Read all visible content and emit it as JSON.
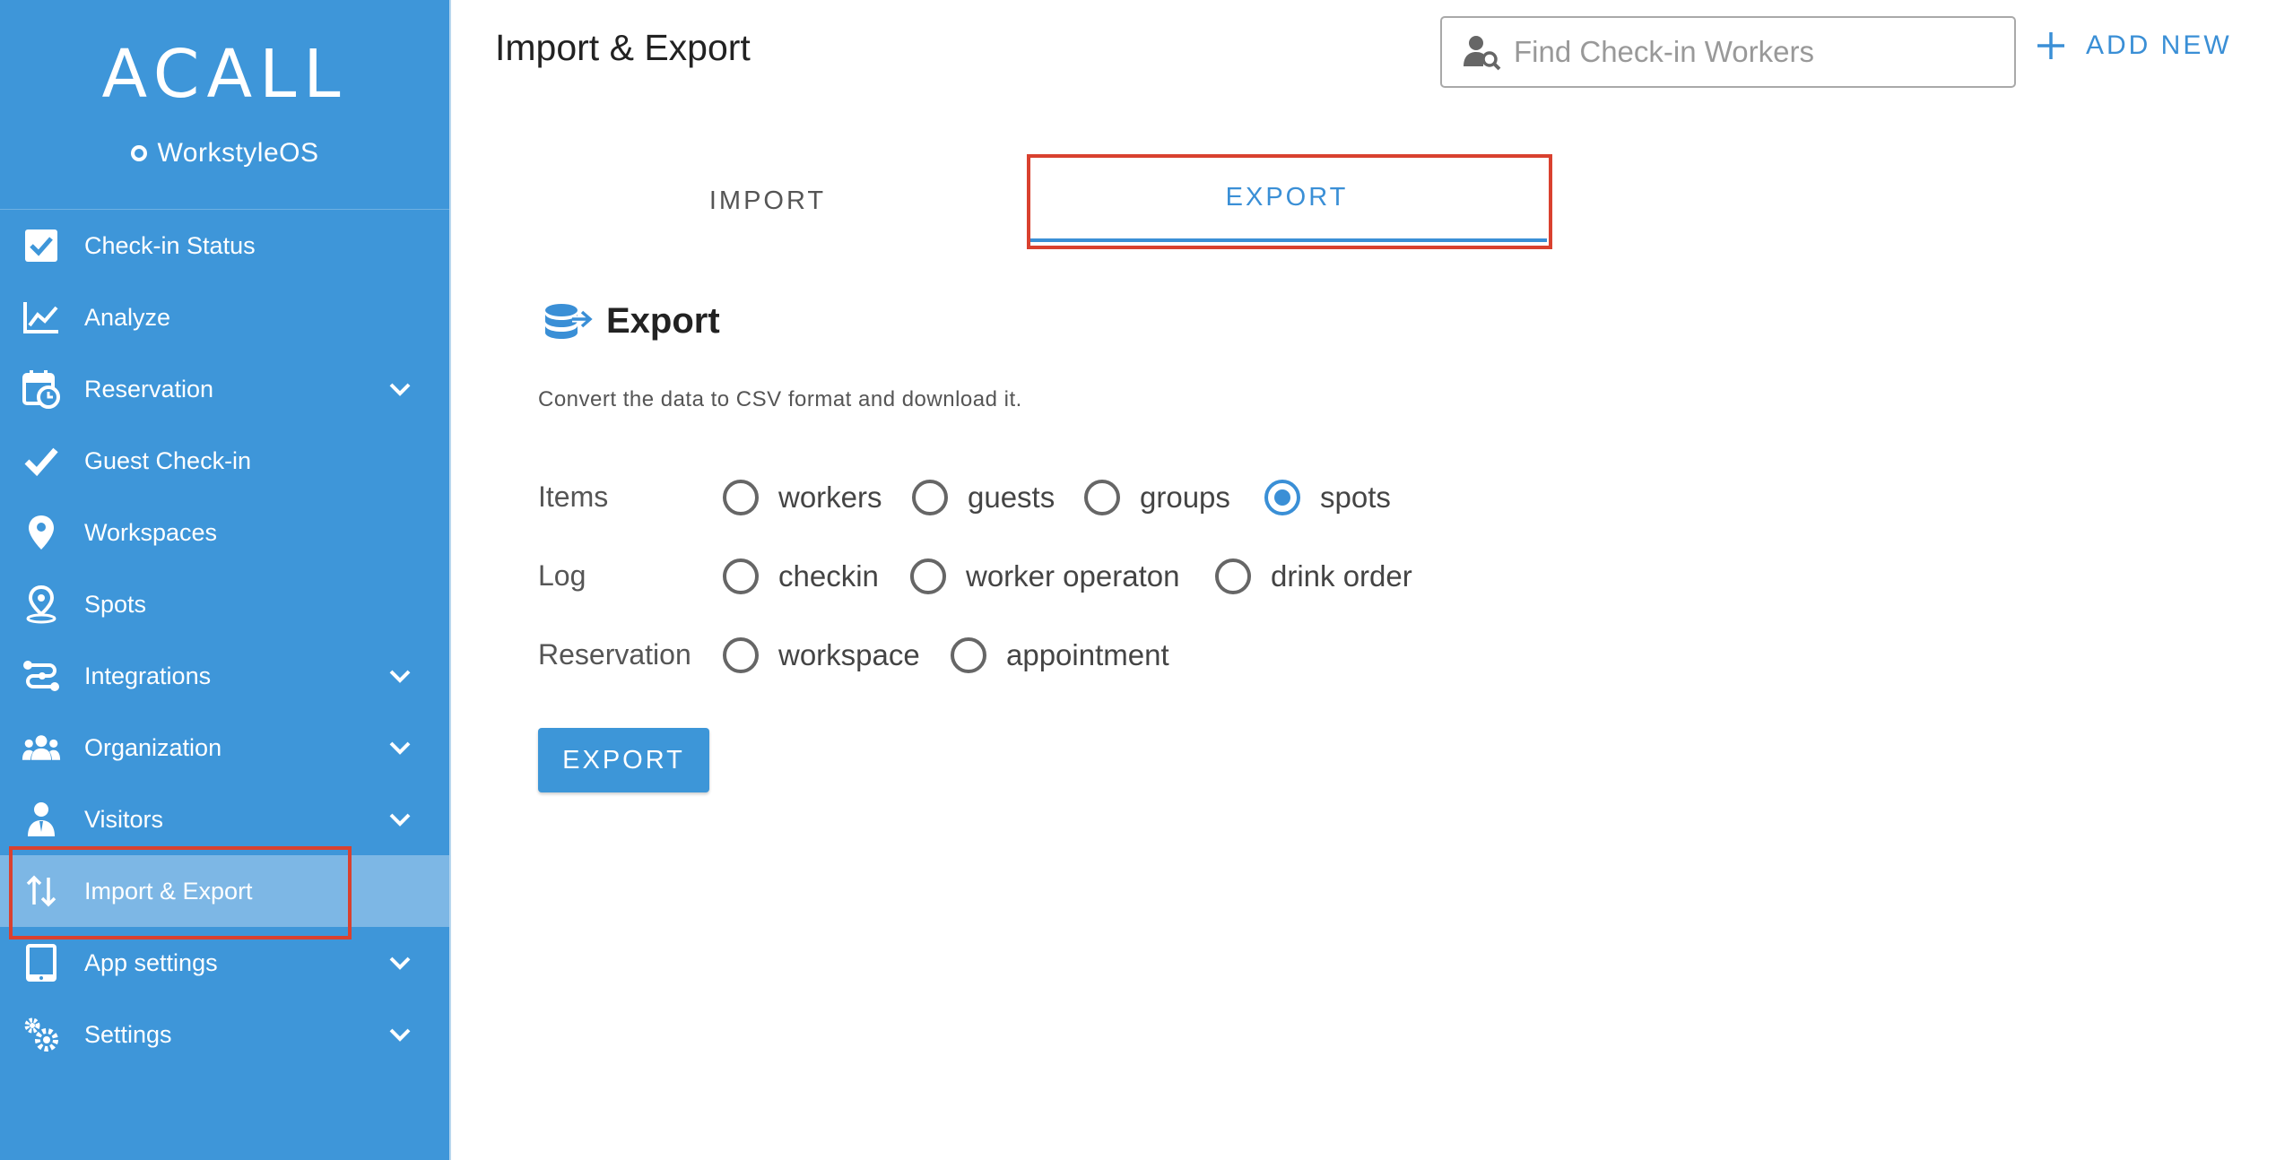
{
  "brand": {
    "logo": "ACALL",
    "subtitle": "WorkstyleOS"
  },
  "sidebar": {
    "items": [
      {
        "label": "Check-in Status",
        "icon": "checkbox-icon",
        "has_chevron": false
      },
      {
        "label": "Analyze",
        "icon": "line-chart-icon",
        "has_chevron": false
      },
      {
        "label": "Reservation",
        "icon": "calendar-clock-icon",
        "has_chevron": true
      },
      {
        "label": "Guest Check-in",
        "icon": "checkmark-icon",
        "has_chevron": false
      },
      {
        "label": "Workspaces",
        "icon": "map-pin-icon",
        "has_chevron": false
      },
      {
        "label": "Spots",
        "icon": "location-pin-icon",
        "has_chevron": false
      },
      {
        "label": "Integrations",
        "icon": "integrations-icon",
        "has_chevron": true
      },
      {
        "label": "Organization",
        "icon": "people-icon",
        "has_chevron": true
      },
      {
        "label": "Visitors",
        "icon": "visitor-icon",
        "has_chevron": true
      },
      {
        "label": "Import & Export",
        "icon": "arrows-up-down-icon",
        "has_chevron": false,
        "active": true
      },
      {
        "label": "App settings",
        "icon": "tablet-icon",
        "has_chevron": true
      },
      {
        "label": "Settings",
        "icon": "gears-icon",
        "has_chevron": true
      }
    ]
  },
  "header": {
    "title": "Import & Export",
    "search_placeholder": "Find Check-in Workers",
    "add_new_label": "ADD NEW"
  },
  "tabs": [
    {
      "label": "IMPORT",
      "active": false
    },
    {
      "label": "EXPORT",
      "active": true
    }
  ],
  "export": {
    "title": "Export",
    "description": "Convert the data to CSV format and download it.",
    "rows": [
      {
        "label": "Items",
        "options": [
          "workers",
          "guests",
          "groups",
          "spots"
        ],
        "selected": "spots"
      },
      {
        "label": "Log",
        "options": [
          "checkin",
          "worker operaton",
          "drink order"
        ],
        "selected": null
      },
      {
        "label": "Reservation",
        "options": [
          "workspace",
          "appointment"
        ],
        "selected": null
      }
    ],
    "button_label": "EXPORT"
  },
  "colors": {
    "sidebar_bg": "#3e96d9",
    "sidebar_active": "#7db7e5",
    "accent": "#3a8fd6",
    "highlight_box": "#d9412f"
  }
}
